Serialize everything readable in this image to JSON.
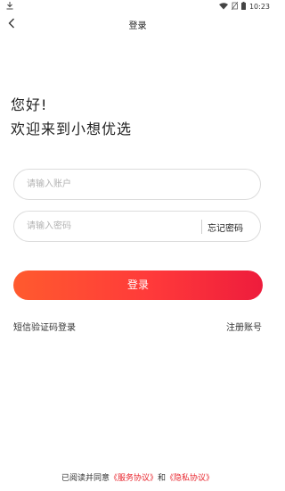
{
  "status_bar": {
    "time": "10:23",
    "icons": [
      "download-icon",
      "wifi-icon",
      "no-sim-icon",
      "battery-icon"
    ]
  },
  "header": {
    "title": "登录",
    "back_icon": "chevron-left-icon"
  },
  "greeting": {
    "line1": "您好!",
    "line2": "欢迎来到小想优选"
  },
  "form": {
    "account_placeholder": "请输入账户",
    "account_value": "",
    "password_placeholder": "请输入密码",
    "password_value": "",
    "forgot_label": "忘记密码",
    "login_label": "登录",
    "sms_login_label": "短信验证码登录",
    "register_label": "注册账号"
  },
  "agreement": {
    "prefix": "已阅读并同意",
    "service_link": "《服务协议》",
    "conjunction": "和",
    "privacy_link": "《隐私协议》"
  },
  "colors": {
    "accent_start": "#ff5a2e",
    "accent_end": "#ee1c3c",
    "link_red": "#e8242c"
  }
}
